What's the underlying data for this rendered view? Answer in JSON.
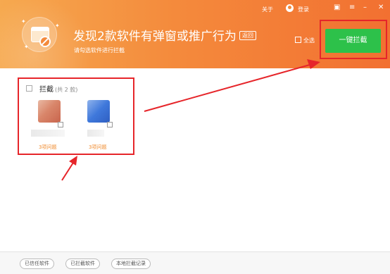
{
  "window": {
    "title": "发现2款软件有弹窗或推广行为",
    "subtitle": "请勾选软件进行拦截",
    "back_label": "返回"
  },
  "titlebar": {
    "about": "关于",
    "login": "登录",
    "icons": [
      "shirt-icon",
      "menu-icon",
      "minimize-icon",
      "close-icon"
    ]
  },
  "actions": {
    "select_all": "全选",
    "block_all": "一键拦截"
  },
  "group": {
    "title": "拦截",
    "count": "(共 2 款)",
    "apps": [
      {
        "issues": "3项问题",
        "checked": false
      },
      {
        "issues": "3项问题",
        "checked": false
      }
    ]
  },
  "footer": {
    "trusted": "已信任软件",
    "blocked": "已拦截软件",
    "records": "本地拦截记录"
  },
  "colors": {
    "header_start": "#f6a94f",
    "header_end": "#f27031",
    "primary_button": "#2dc14a",
    "highlight": "#e6252a",
    "issue_text": "#f08a2c"
  }
}
